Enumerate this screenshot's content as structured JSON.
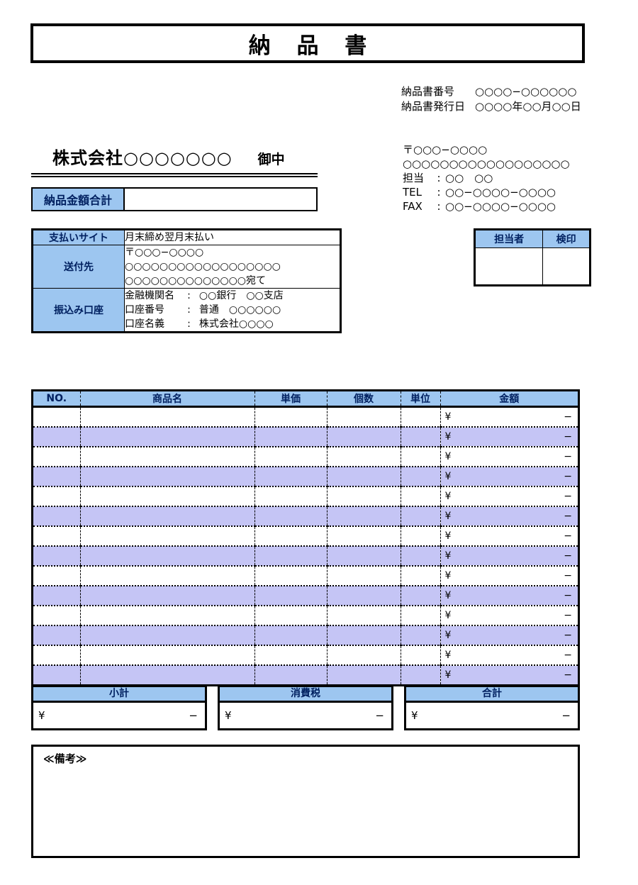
{
  "document": {
    "title": "納 品 書"
  },
  "meta": {
    "number_label": "納品書番号",
    "number_value": "○○○○−○○○○○○",
    "date_label": "納品書発行日",
    "date_value": "○○○○年○○月○○日"
  },
  "recipient": {
    "company": "株式会社○○○○○○○",
    "honorific": "御中",
    "total_label": "納品金額合計",
    "total_value": ""
  },
  "sender": {
    "postal": "〒○○○−○○○○",
    "address": "○○○○○○○○○○○○○○○○○○",
    "contact_key": "担当",
    "contact_value": "○○　○○",
    "tel_key": "TEL",
    "tel_value": "○○−○○○○−○○○○",
    "fax_key": "FAX",
    "fax_value": "○○−○○○○−○○○○"
  },
  "payment": {
    "site_label": "支払いサイト",
    "site_value": "月末締め翌月末払い",
    "shipto_label": "送付先",
    "shipto_lines": [
      "〒○○○−○○○○",
      "○○○○○○○○○○○○○○○○○○",
      "○○○○○○○○○○○○○○宛て"
    ],
    "bank_label": "振込み口座",
    "bank_rows": [
      {
        "key": "金融機関名",
        "value": "○○銀行　○○支店"
      },
      {
        "key": "口座番号",
        "value": "普通　○○○○○○"
      },
      {
        "key": "口座名義",
        "value": "株式会社○○○○"
      }
    ]
  },
  "stamp": {
    "headers": [
      "担当者",
      "検印"
    ],
    "cells": [
      "",
      ""
    ]
  },
  "items": {
    "headers": [
      "NO.",
      "商品名",
      "単価",
      "個数",
      "単位",
      "金額"
    ],
    "currency_symbol": "¥",
    "dash": "−",
    "rows": [
      {
        "no": "",
        "name": "",
        "price": "",
        "qty": "",
        "unit": "",
        "amount": ""
      },
      {
        "no": "",
        "name": "",
        "price": "",
        "qty": "",
        "unit": "",
        "amount": ""
      },
      {
        "no": "",
        "name": "",
        "price": "",
        "qty": "",
        "unit": "",
        "amount": ""
      },
      {
        "no": "",
        "name": "",
        "price": "",
        "qty": "",
        "unit": "",
        "amount": ""
      },
      {
        "no": "",
        "name": "",
        "price": "",
        "qty": "",
        "unit": "",
        "amount": ""
      },
      {
        "no": "",
        "name": "",
        "price": "",
        "qty": "",
        "unit": "",
        "amount": ""
      },
      {
        "no": "",
        "name": "",
        "price": "",
        "qty": "",
        "unit": "",
        "amount": ""
      },
      {
        "no": "",
        "name": "",
        "price": "",
        "qty": "",
        "unit": "",
        "amount": ""
      },
      {
        "no": "",
        "name": "",
        "price": "",
        "qty": "",
        "unit": "",
        "amount": ""
      },
      {
        "no": "",
        "name": "",
        "price": "",
        "qty": "",
        "unit": "",
        "amount": ""
      },
      {
        "no": "",
        "name": "",
        "price": "",
        "qty": "",
        "unit": "",
        "amount": ""
      },
      {
        "no": "",
        "name": "",
        "price": "",
        "qty": "",
        "unit": "",
        "amount": ""
      },
      {
        "no": "",
        "name": "",
        "price": "",
        "qty": "",
        "unit": "",
        "amount": ""
      },
      {
        "no": "",
        "name": "",
        "price": "",
        "qty": "",
        "unit": "",
        "amount": ""
      }
    ]
  },
  "totals": [
    {
      "label": "小計",
      "currency": "¥",
      "value": "",
      "dash": "−"
    },
    {
      "label": "消費税",
      "currency": "¥",
      "value": "",
      "dash": "−"
    },
    {
      "label": "合計",
      "currency": "¥",
      "value": "",
      "dash": "−"
    }
  ],
  "remarks": {
    "label": "≪備考≫",
    "value": ""
  },
  "colors": {
    "header_blue": "#9dc6f0",
    "row_tint": "#c5c5f5",
    "header_text": "#002060",
    "border": "#000000"
  }
}
